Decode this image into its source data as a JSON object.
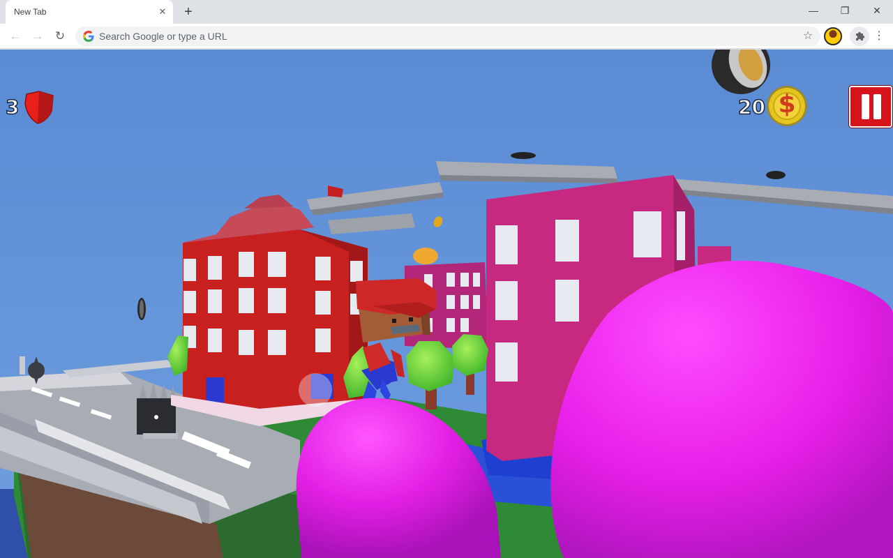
{
  "browser": {
    "tab_title": "New Tab",
    "tab_close_glyph": "✕",
    "new_tab_glyph": "+",
    "omnibox_placeholder": "Search Google or type a URL",
    "controls": {
      "back": "←",
      "forward": "→",
      "reload": "↻",
      "star": "☆",
      "menu": "⋮",
      "minimize": "—",
      "restore": "❐",
      "close": "✕"
    }
  },
  "hud": {
    "lives": "3",
    "coins": "20",
    "coin_symbol": "$"
  },
  "icons": [
    "google-icon",
    "star-icon",
    "puzzle-extension-icon",
    "shield-icon",
    "coin-icon",
    "pause-icon"
  ],
  "colors": {
    "sky": "#5f8fd4",
    "pause_button": "#d7141b",
    "shield": "#e8201c",
    "coin": "#e6c41e",
    "balloon": "#e81fe8"
  }
}
